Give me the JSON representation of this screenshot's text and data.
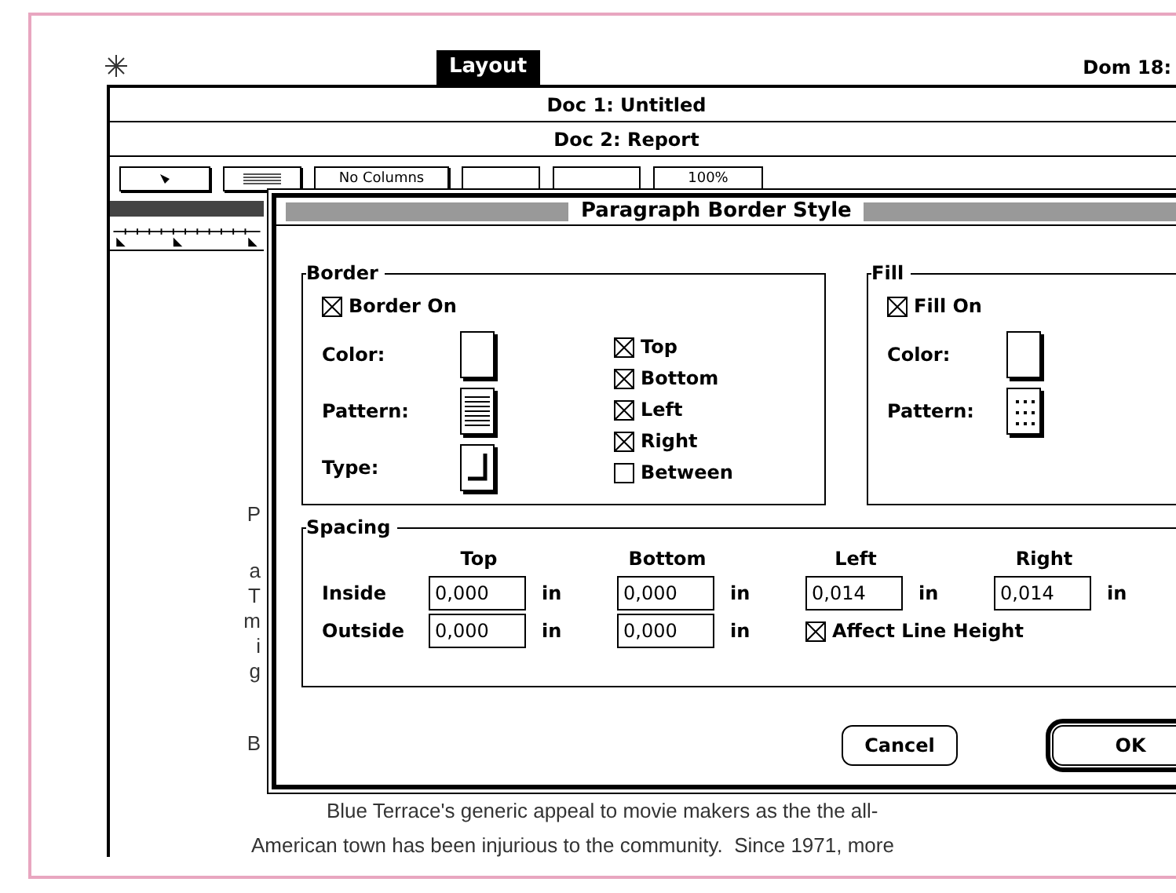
{
  "menu_bar": {
    "title": "Layout",
    "clock": "Dom 18:"
  },
  "windows": [
    {
      "title": "Doc 1: Untitled"
    },
    {
      "title": "Doc 2: Report"
    }
  ],
  "toolbar": {
    "columns": "No Columns",
    "zoom": "100%"
  },
  "document": {
    "fragments": [
      "P",
      "a",
      "T",
      "m",
      "i",
      "g",
      "B"
    ],
    "lines": [
      "Blue Terrace's generic appeal to movie makers as the the all-",
      "American town has been injurious to the community.  Since 1971, more"
    ]
  },
  "dialog": {
    "title": "Paragraph Border Style",
    "border": {
      "label": "Border",
      "enabled": {
        "label": "Border On",
        "checked": true
      },
      "color_label": "Color:",
      "pattern_label": "Pattern:",
      "type_label": "Type:",
      "sides": [
        {
          "label": "Top",
          "checked": true
        },
        {
          "label": "Bottom",
          "checked": true
        },
        {
          "label": "Left",
          "checked": true
        },
        {
          "label": "Right",
          "checked": true
        },
        {
          "label": "Between",
          "checked": false
        }
      ]
    },
    "fill": {
      "label": "Fill",
      "enabled": {
        "label": "Fill On",
        "checked": true
      },
      "color_label": "Color:",
      "pattern_label": "Pattern:"
    },
    "spacing": {
      "label": "Spacing",
      "columns": [
        "Top",
        "Bottom",
        "Left",
        "Right"
      ],
      "rows": [
        {
          "label": "Inside",
          "values": [
            {
              "value": "0,000",
              "unit": "in"
            },
            {
              "value": "0,000",
              "unit": "in"
            },
            {
              "value": "0,014",
              "unit": "in"
            },
            {
              "value": "0,014",
              "unit": "in"
            }
          ]
        },
        {
          "label": "Outside",
          "values": [
            {
              "value": "0,000",
              "unit": "in"
            },
            {
              "value": "0,000",
              "unit": "in"
            }
          ]
        }
      ],
      "affect_line_height": {
        "label": "Affect Line Height",
        "checked": true
      }
    },
    "buttons": [
      {
        "label": "Cancel",
        "default": false
      },
      {
        "label": "OK",
        "default": true
      }
    ]
  }
}
